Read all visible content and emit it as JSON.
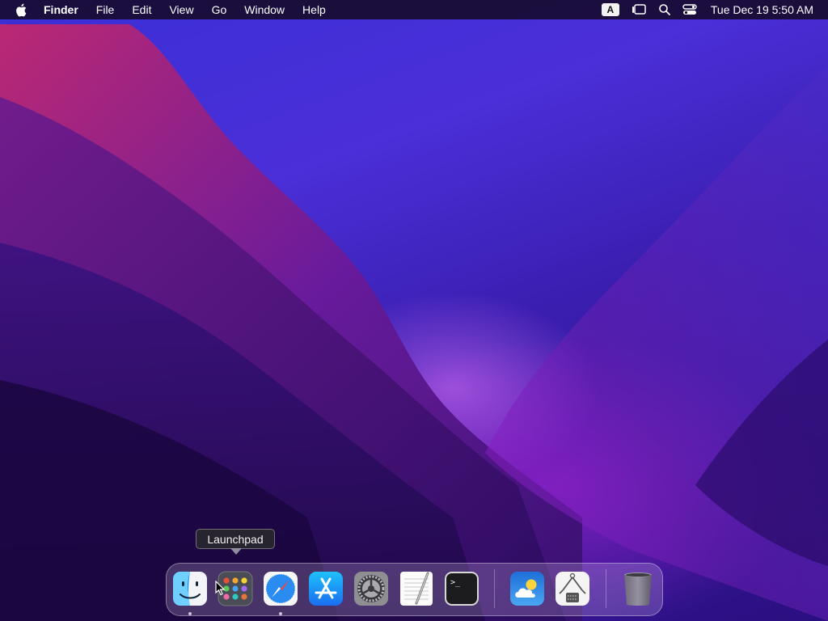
{
  "menubar": {
    "app_name": "Finder",
    "menus": [
      "File",
      "Edit",
      "View",
      "Go",
      "Window",
      "Help"
    ],
    "input_source": "A",
    "clock": "Tue Dec 19  5:50 AM"
  },
  "tooltip": {
    "label": "Launchpad"
  },
  "dock": {
    "items": [
      {
        "name": "Finder",
        "icon": "finder-icon",
        "running": true
      },
      {
        "name": "Launchpad",
        "icon": "launchpad-icon",
        "running": false
      },
      {
        "name": "Safari",
        "icon": "safari-icon",
        "running": true
      },
      {
        "name": "App Store",
        "icon": "app-store-icon",
        "running": false
      },
      {
        "name": "System Settings",
        "icon": "system-settings-icon",
        "running": false
      },
      {
        "name": "TextEdit",
        "icon": "textedit-icon",
        "running": false
      },
      {
        "name": "Terminal",
        "icon": "terminal-icon",
        "running": false
      },
      {
        "name": "Weather",
        "icon": "weather-icon",
        "running": false
      },
      {
        "name": "Archive Utility",
        "icon": "archive-utility-icon",
        "running": false
      },
      {
        "name": "Trash",
        "icon": "trash-icon",
        "running": false
      }
    ],
    "terminal_prompt": ">_"
  },
  "colors": {
    "menubar_bg": "#140a28",
    "wallpaper_top": "#3a2fd6",
    "wallpaper_glow": "#e678ff"
  }
}
